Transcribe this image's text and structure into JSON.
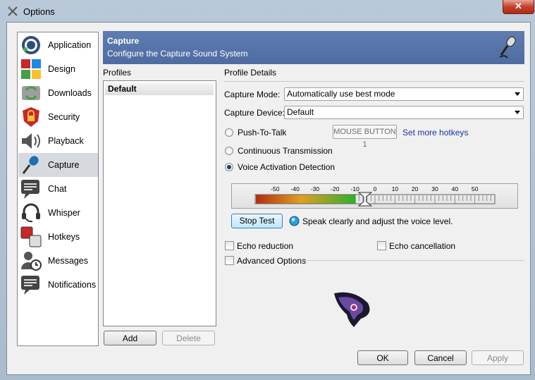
{
  "window": {
    "title": "Options",
    "close_glyph": "✕"
  },
  "sidebar": {
    "items": [
      {
        "label": "Application",
        "icon": "teamspeak-icon"
      },
      {
        "label": "Design",
        "icon": "palette-icon"
      },
      {
        "label": "Downloads",
        "icon": "downloads-icon"
      },
      {
        "label": "Security",
        "icon": "lock-icon"
      },
      {
        "label": "Playback",
        "icon": "speaker-icon"
      },
      {
        "label": "Capture",
        "icon": "microphone-icon",
        "selected": true
      },
      {
        "label": "Chat",
        "icon": "chat-icon"
      },
      {
        "label": "Whisper",
        "icon": "headset-icon"
      },
      {
        "label": "Hotkeys",
        "icon": "hotkeys-icon"
      },
      {
        "label": "Messages",
        "icon": "messages-icon"
      },
      {
        "label": "Notifications",
        "icon": "notifications-icon"
      }
    ]
  },
  "banner": {
    "title": "Capture",
    "subtitle": "Configure the Capture Sound System",
    "icon": "microphone-icon"
  },
  "profiles": {
    "heading": "Profiles",
    "items": [
      "Default"
    ],
    "add_label": "Add",
    "delete_label": "Delete"
  },
  "details": {
    "heading": "Profile Details",
    "capture_mode_label": "Capture Mode:",
    "capture_mode_value": "Automatically use best mode",
    "capture_device_label": "Capture Device:",
    "capture_device_value": "Default",
    "push_to_talk_label": "Push-To-Talk",
    "hotkey_value": "MOUSE BUTTON 1",
    "set_hotkeys_link": "Set more hotkeys",
    "continuous_label": "Continuous Transmission",
    "vad_label": "Voice Activation Detection",
    "selected_mode": "vad",
    "meter": {
      "ticks": [
        -50,
        -40,
        -30,
        -20,
        -10,
        0,
        10,
        20,
        30,
        40,
        50
      ],
      "level_db": -10,
      "threshold_db": -5
    },
    "stop_test_label": "Stop Test",
    "test_hint": "Speak clearly and adjust the voice level.",
    "echo_reduction_label": "Echo reduction",
    "echo_cancellation_label": "Echo cancellation",
    "advanced_options_label": "Advanced Options"
  },
  "footer": {
    "ok_label": "OK",
    "cancel_label": "Cancel",
    "apply_label": "Apply"
  },
  "colors": {
    "banner": "#5270a6",
    "link": "#1a33a6",
    "selected_nav": "#d6d9de"
  }
}
